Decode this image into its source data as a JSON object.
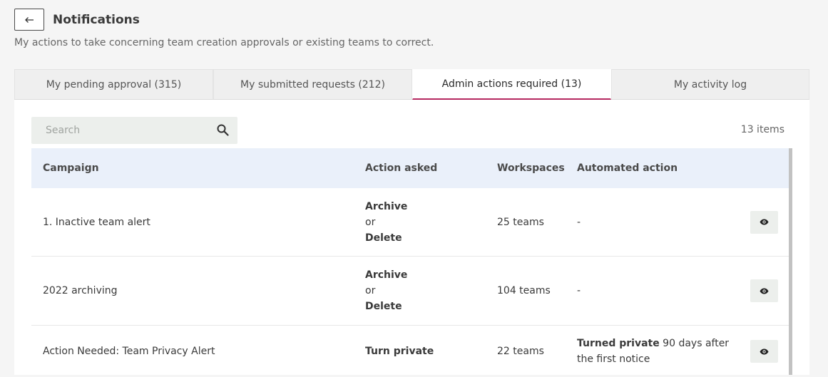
{
  "header": {
    "title": "Notifications",
    "subtitle": "My actions to take concerning team creation approvals or existing teams to correct."
  },
  "tabs": [
    {
      "label": "My pending approval (315)",
      "active": false
    },
    {
      "label": "My submitted requests (212)",
      "active": false
    },
    {
      "label": "Admin actions required (13)",
      "active": true
    },
    {
      "label": "My activity log",
      "active": false
    }
  ],
  "search": {
    "placeholder": "Search",
    "value": ""
  },
  "items_count": "13 items",
  "table": {
    "columns": [
      "Campaign",
      "Action asked",
      "Workspaces",
      "Automated action"
    ],
    "rows": [
      {
        "campaign": "1. Inactive team alert",
        "action_1": "Archive",
        "action_or": "or",
        "action_2": "Delete",
        "workspaces": "25 teams",
        "automated": "-"
      },
      {
        "campaign": "2022 archiving",
        "action_1": "Archive",
        "action_or": "or",
        "action_2": "Delete",
        "workspaces": "104 teams",
        "automated": "-"
      },
      {
        "campaign": "Action Needed: Team Privacy Alert",
        "action_1": "Turn private",
        "workspaces": "22 teams",
        "automated_bold": "Turned private",
        "automated_rest": " 90 days after",
        "automated_line2": "the first notice"
      }
    ]
  },
  "colors": {
    "accent": "#b52860",
    "header_bg": "#eaf0fa",
    "page_bg": "#f5f5f5"
  },
  "icons": {
    "back": "arrow-left-icon",
    "search": "search-icon",
    "view": "eye-icon"
  }
}
